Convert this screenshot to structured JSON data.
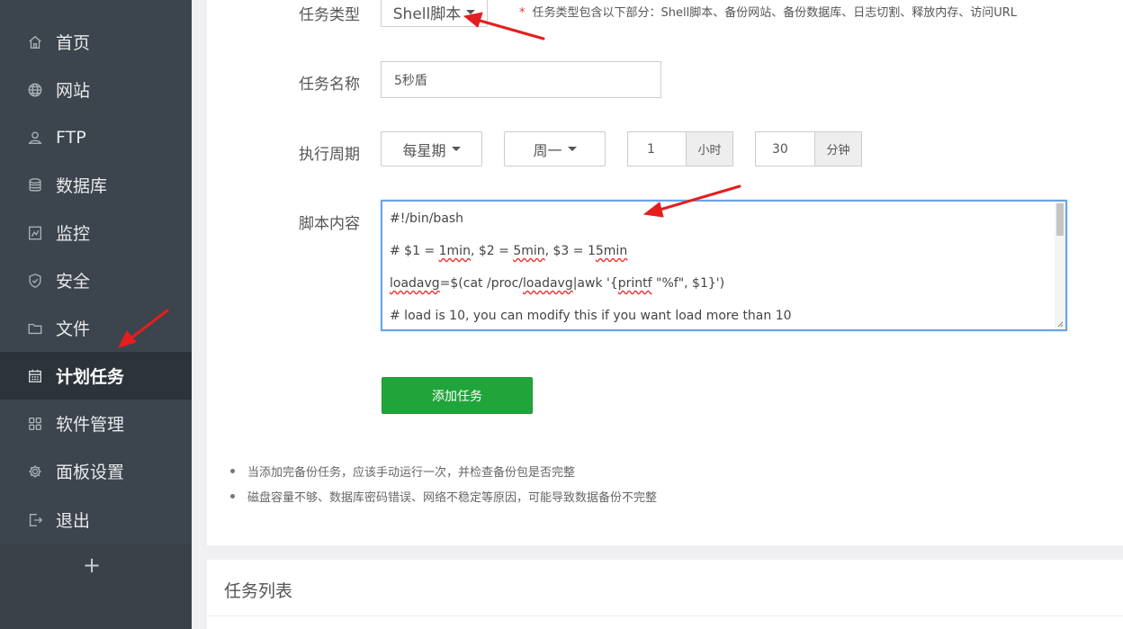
{
  "sidebar": {
    "items": [
      {
        "label": "首页",
        "icon": "home-icon"
      },
      {
        "label": "网站",
        "icon": "globe-icon"
      },
      {
        "label": "FTP",
        "icon": "ftp-user-icon"
      },
      {
        "label": "数据库",
        "icon": "database-icon"
      },
      {
        "label": "监控",
        "icon": "monitor-icon"
      },
      {
        "label": "安全",
        "icon": "shield-icon"
      },
      {
        "label": "文件",
        "icon": "folder-icon"
      },
      {
        "label": "计划任务",
        "icon": "calendar-icon",
        "active": true
      },
      {
        "label": "软件管理",
        "icon": "grid-icon"
      },
      {
        "label": "面板设置",
        "icon": "gear-icon"
      },
      {
        "label": "退出",
        "icon": "logout-icon"
      }
    ],
    "add_label": "+"
  },
  "form": {
    "task_type": {
      "label": "任务类型",
      "value": "Shell脚本"
    },
    "hint": {
      "star": "*",
      "text": "任务类型包含以下部分：Shell脚本、备份网站、备份数据库、日志切割、释放内存、访问URL"
    },
    "task_name": {
      "label": "任务名称",
      "value": "5秒盾"
    },
    "period": {
      "label": "执行周期",
      "cycle": "每星期",
      "weekday": "周一",
      "hour": "1",
      "hour_unit": "小时",
      "minute": "30",
      "minute_unit": "分钟"
    },
    "script": {
      "label": "脚本内容",
      "lines": [
        "#!/bin/bash",
        "# $1 = 1min, $2 = 5min, $3 = 15min",
        "loadavg=$(cat /proc/loadavg|awk '{printf \"%f\", $1}')",
        "# load is 10, you can modify this if you want load more than 10"
      ]
    },
    "submit_label": "添加任务"
  },
  "notes": [
    "当添加完备份任务，应该手动运行一次，并检查备份包是否完整",
    "磁盘容量不够、数据库密码错误、网络不稳定等原因，可能导致数据备份不完整"
  ],
  "task_list": {
    "title": "任务列表"
  },
  "colors": {
    "sidebar_bg": "#3c444d",
    "sidebar_active_bg": "#2d333a",
    "accent_green": "#20a53a",
    "annotation_red": "#e41e1e",
    "focus_blue": "#69a4e8"
  }
}
